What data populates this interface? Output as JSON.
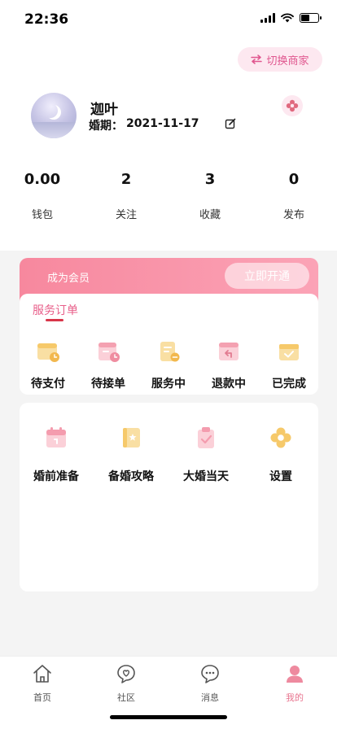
{
  "status_bar": {
    "time": "22:36",
    "battery_level": 0.5
  },
  "header": {
    "switch_label": "切换商家"
  },
  "profile": {
    "name": "迦叶",
    "wedding_label": "婚期：",
    "wedding_date": "2021-11-17"
  },
  "stats": [
    {
      "value": "0.00",
      "label": "钱包"
    },
    {
      "value": "2",
      "label": "关注"
    },
    {
      "value": "3",
      "label": "收藏"
    },
    {
      "value": "0",
      "label": "发布"
    }
  ],
  "member": {
    "text": "成为会员",
    "button": "立即开通"
  },
  "orders": {
    "title": "服务订单",
    "items": [
      {
        "label": "待支付",
        "icon": "wallet-clock-icon"
      },
      {
        "label": "待接单",
        "icon": "calendar-clock-icon"
      },
      {
        "label": "服务中",
        "icon": "document-progress-icon"
      },
      {
        "label": "退款中",
        "icon": "refund-icon"
      },
      {
        "label": "已完成",
        "icon": "box-check-icon"
      }
    ]
  },
  "tools": [
    {
      "label": "婚前准备",
      "icon": "calendar-icon"
    },
    {
      "label": "备婚攻略",
      "icon": "guide-book-icon"
    },
    {
      "label": "大婚当天",
      "icon": "clipboard-check-icon"
    },
    {
      "label": "设置",
      "icon": "settings-flower-icon"
    }
  ],
  "tabbar": [
    {
      "label": "首页",
      "icon": "home-icon"
    },
    {
      "label": "社区",
      "icon": "community-icon"
    },
    {
      "label": "消息",
      "icon": "message-icon"
    },
    {
      "label": "我的",
      "icon": "profile-icon",
      "active": true
    }
  ],
  "colors": {
    "accent_pink": "#e8758f",
    "member_gradient_start": "#f7889e",
    "underline_red": "#d8364a"
  }
}
